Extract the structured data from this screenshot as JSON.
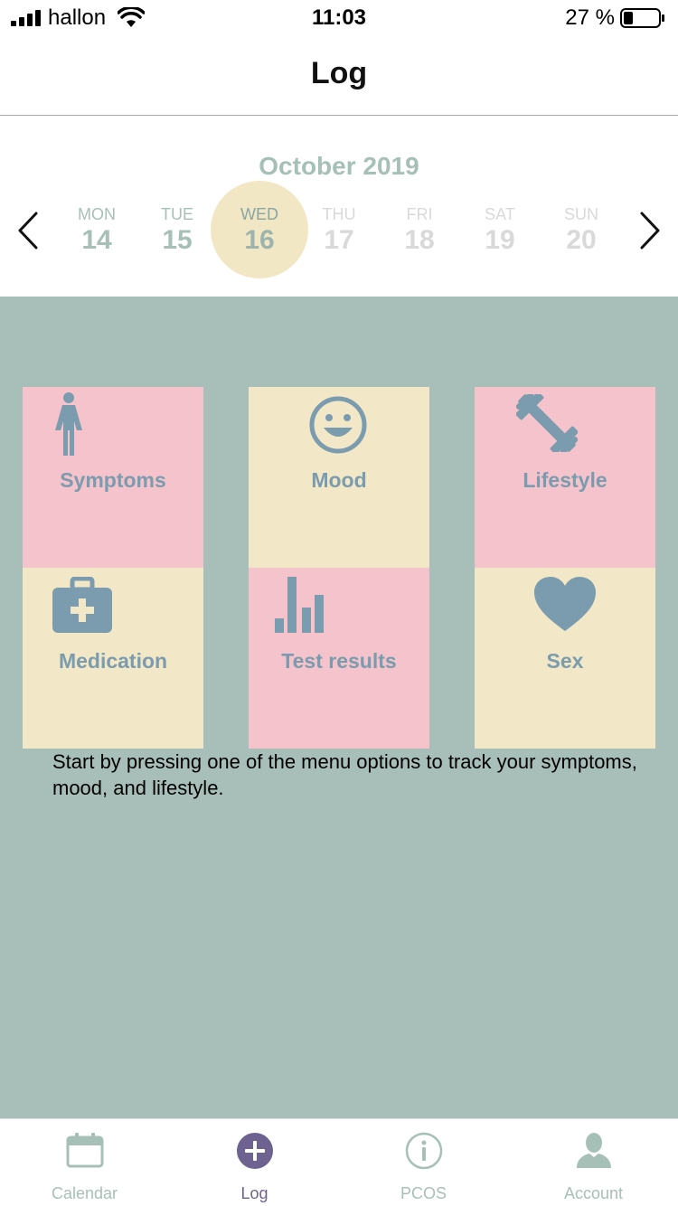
{
  "status_bar": {
    "carrier": "hallon",
    "time": "11:03",
    "battery_percent": "27 %",
    "battery_level": 0.27
  },
  "header": {
    "title": "Log"
  },
  "week": {
    "month": "October 2019",
    "days": [
      {
        "dow": "MON",
        "num": "14"
      },
      {
        "dow": "TUE",
        "num": "15"
      },
      {
        "dow": "WED",
        "num": "16"
      },
      {
        "dow": "THU",
        "num": "17"
      },
      {
        "dow": "FRI",
        "num": "18"
      },
      {
        "dow": "SAT",
        "num": "19"
      },
      {
        "dow": "SUN",
        "num": "20"
      }
    ]
  },
  "categories": [
    {
      "label": "Symptoms",
      "icon": "woman-icon",
      "color": "#f4c3cb"
    },
    {
      "label": "Mood",
      "icon": "smiley-icon",
      "color": "#f2e7c6"
    },
    {
      "label": "Lifestyle",
      "icon": "dumbbell-icon",
      "color": "#f4c3cb"
    },
    {
      "label": "Medication",
      "icon": "first-aid-kit-icon",
      "color": "#f2e7c6"
    },
    {
      "label": "Test results",
      "icon": "bar-chart-icon",
      "color": "#f4c3cb"
    },
    {
      "label": "Sex",
      "icon": "heart-icon",
      "color": "#f2e7c6"
    }
  ],
  "hint": "Start by pressing one of the menu options to track your symptoms, mood, and lifestyle.",
  "tab_bar": {
    "tabs": [
      {
        "label": "Calendar",
        "icon": "calendar-icon"
      },
      {
        "label": "Log",
        "icon": "plus-circle-icon"
      },
      {
        "label": "PCOS",
        "icon": "info-icon"
      },
      {
        "label": "Account",
        "icon": "person-icon"
      }
    ]
  },
  "colors": {
    "accent": "#a7c0b7",
    "background_main": "#a7bfb8",
    "tile_pink": "#f4c3cb",
    "tile_cream": "#f2e7c6",
    "icon_blue": "#7b9cae",
    "tab_active": "#6d6290"
  }
}
